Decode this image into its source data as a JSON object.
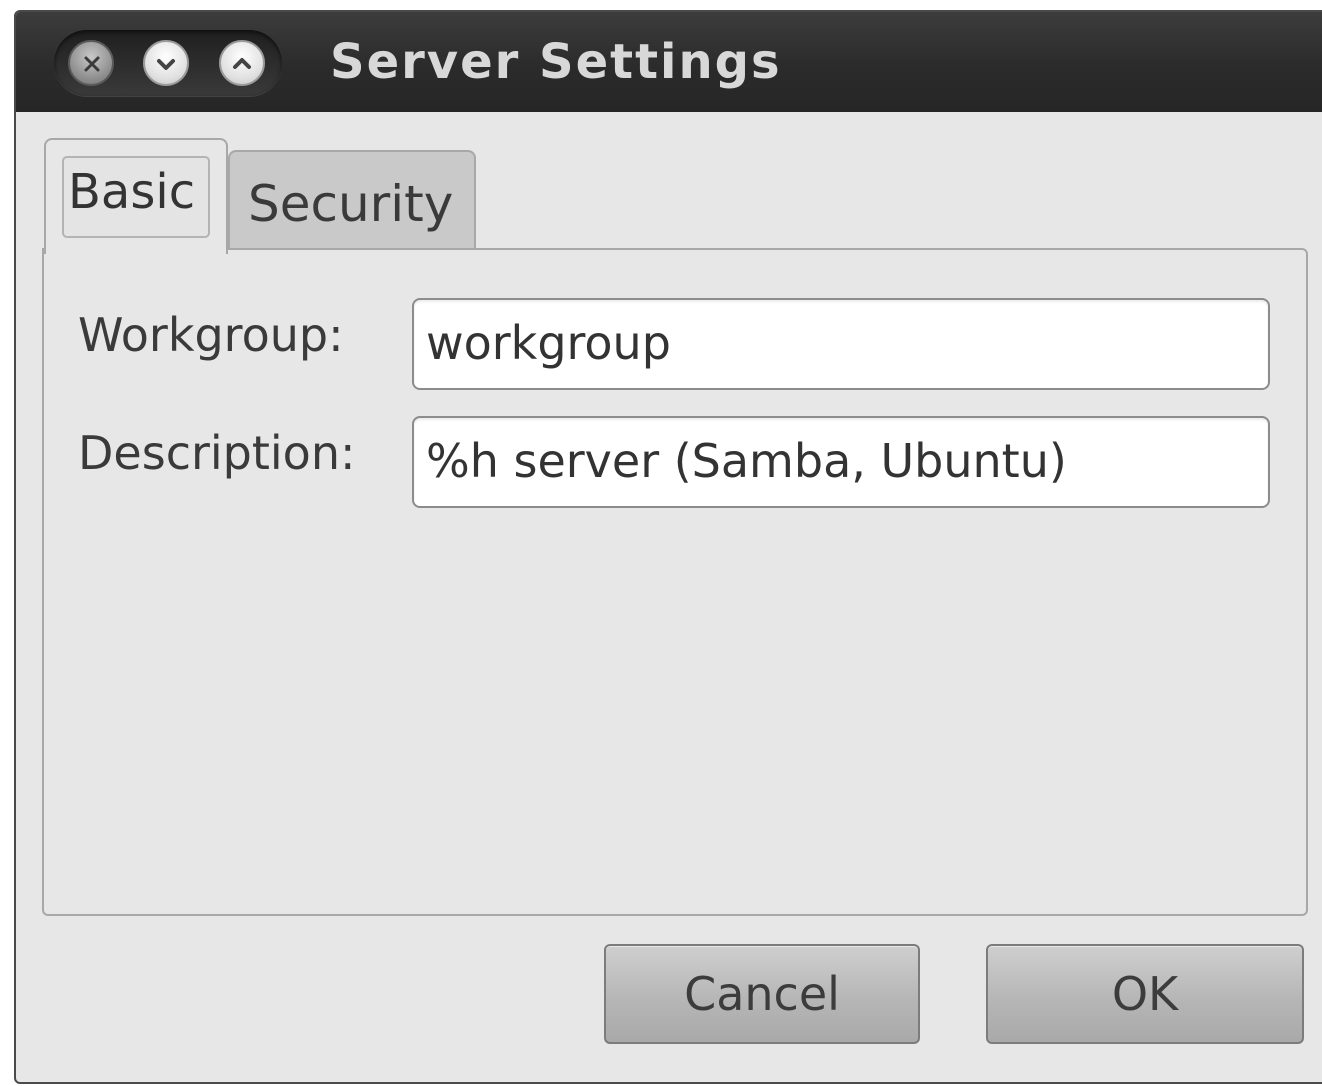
{
  "window": {
    "title": "Server Settings",
    "controls": [
      "close-icon",
      "minimize-icon",
      "maximize-icon"
    ]
  },
  "tabs": [
    {
      "label": "Basic",
      "active": true
    },
    {
      "label": "Security",
      "active": false
    }
  ],
  "form": {
    "workgroup_label": "Workgroup:",
    "workgroup_value": "workgroup",
    "description_label": "Description:",
    "description_value": "%h server (Samba, Ubuntu)"
  },
  "buttons": {
    "cancel_label": "Cancel",
    "ok_label": "OK"
  },
  "colors": {
    "titlebar": "#2b2b2b",
    "window_bg": "#e7e7e7",
    "title_text": "#d8d8d8"
  }
}
